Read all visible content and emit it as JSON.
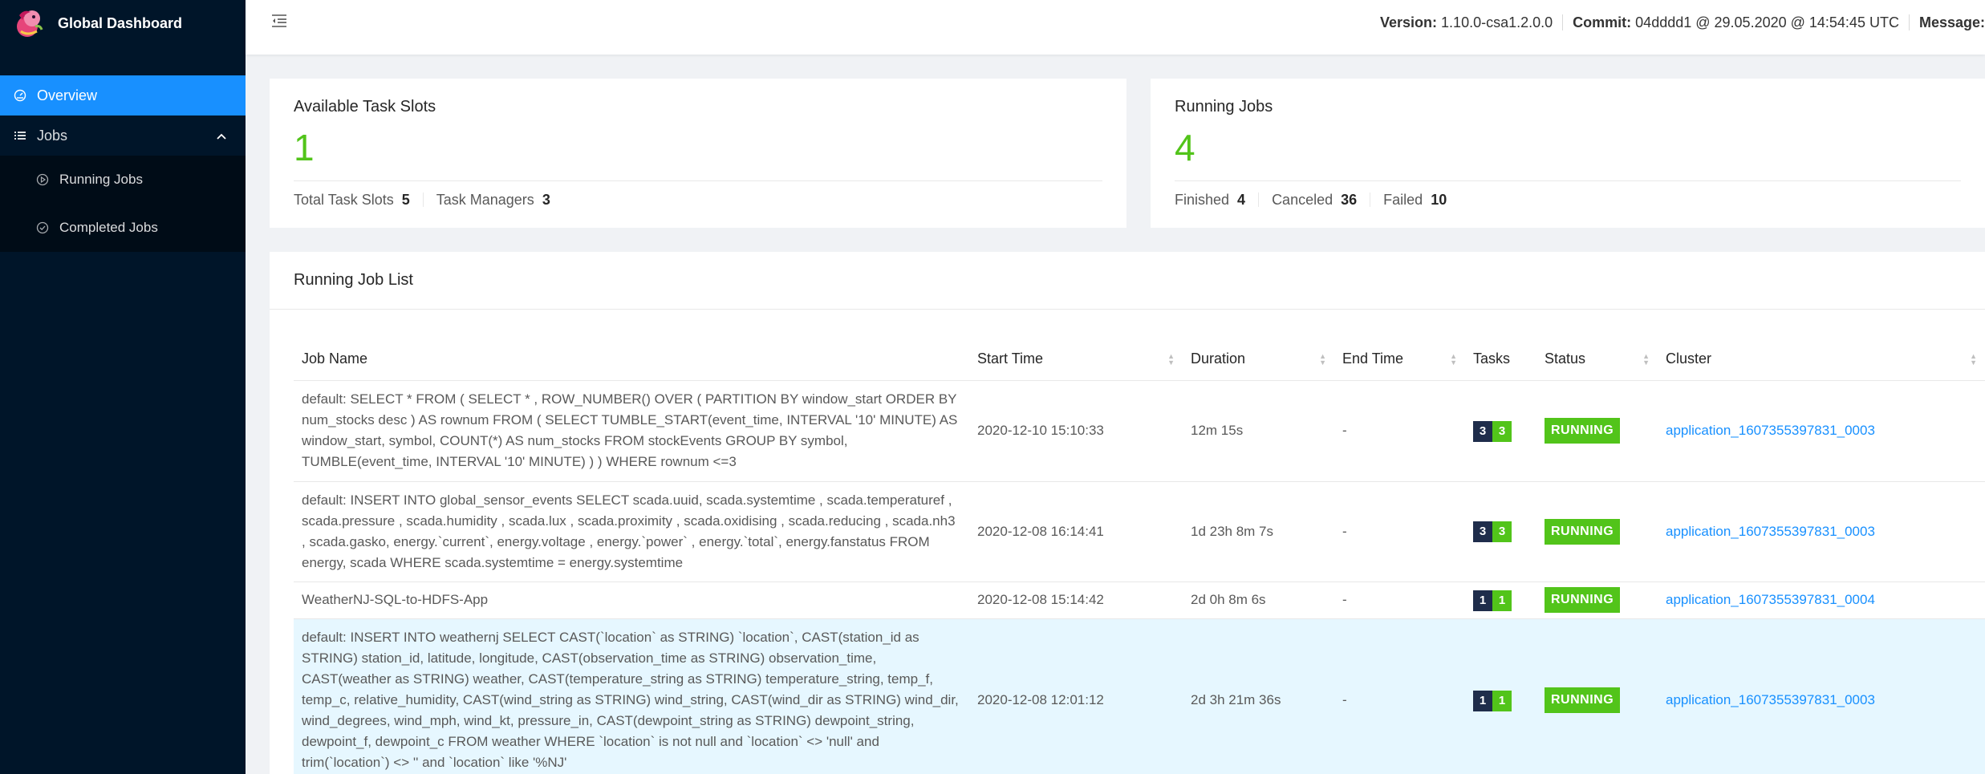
{
  "brand": {
    "title": "Global Dashboard"
  },
  "sidebar": {
    "items": [
      {
        "label": "Overview",
        "icon": "dashboard-icon"
      },
      {
        "label": "Jobs",
        "icon": "list-icon"
      }
    ],
    "jobs_submenu": [
      {
        "label": "Running Jobs",
        "icon": "play-circle-icon"
      },
      {
        "label": "Completed Jobs",
        "icon": "check-circle-icon"
      }
    ]
  },
  "header": {
    "version_label": "Version:",
    "version_value": "1.10.0-csa1.2.0.0",
    "commit_label": "Commit:",
    "commit_value": "04dddd1 @ 29.05.2020 @ 14:54:45 UTC",
    "message_label": "Message:"
  },
  "task_slots": {
    "title": "Available Task Slots",
    "value": "1",
    "total_label": "Total Task Slots",
    "total_value": "5",
    "managers_label": "Task Managers",
    "managers_value": "3"
  },
  "running_jobs": {
    "title": "Running Jobs",
    "value": "4",
    "finished_label": "Finished",
    "finished_value": "4",
    "canceled_label": "Canceled",
    "canceled_value": "36",
    "failed_label": "Failed",
    "failed_value": "10"
  },
  "job_list": {
    "title": "Running Job List",
    "columns": [
      "Job Name",
      "Start Time",
      "Duration",
      "End Time",
      "Tasks",
      "Status",
      "Cluster"
    ],
    "rows": [
      {
        "name": "default: SELECT * FROM ( SELECT * , ROW_NUMBER() OVER ( PARTITION BY window_start ORDER BY num_stocks desc ) AS rownum FROM ( SELECT TUMBLE_START(event_time, INTERVAL '10' MINUTE) AS window_start, symbol, COUNT(*) AS num_stocks FROM stockEvents GROUP BY symbol, TUMBLE(event_time, INTERVAL '10' MINUTE) ) ) WHERE rownum <=3",
        "start": "2020-12-10 15:10:33",
        "duration": "12m 15s",
        "end": "-",
        "tasks_total": "3",
        "tasks_running": "3",
        "status": "RUNNING",
        "cluster": "application_1607355397831_0003"
      },
      {
        "name": "default: INSERT INTO global_sensor_events SELECT scada.uuid, scada.systemtime , scada.temperaturef , scada.pressure , scada.humidity , scada.lux , scada.proximity , scada.oxidising , scada.reducing , scada.nh3 , scada.gasko, energy.`current`, energy.voltage , energy.`power` , energy.`total`, energy.fanstatus FROM energy, scada WHERE scada.systemtime = energy.systemtime",
        "start": "2020-12-08 16:14:41",
        "duration": "1d 23h 8m 7s",
        "end": "-",
        "tasks_total": "3",
        "tasks_running": "3",
        "status": "RUNNING",
        "cluster": "application_1607355397831_0003"
      },
      {
        "name": "WeatherNJ-SQL-to-HDFS-App",
        "start": "2020-12-08 15:14:42",
        "duration": "2d 0h 8m 6s",
        "end": "-",
        "tasks_total": "1",
        "tasks_running": "1",
        "status": "RUNNING",
        "cluster": "application_1607355397831_0004"
      },
      {
        "name": "default: INSERT INTO weathernj SELECT CAST(`location` as STRING) `location`, CAST(station_id as STRING) station_id, latitude, longitude, CAST(observation_time as STRING) observation_time, CAST(weather as STRING) weather, CAST(temperature_string as STRING) temperature_string, temp_f, temp_c, relative_humidity, CAST(wind_string as STRING) wind_string, CAST(wind_dir as STRING) wind_dir, wind_degrees, wind_mph, wind_kt, pressure_in, CAST(dewpoint_string as STRING) dewpoint_string, dewpoint_f, dewpoint_c FROM weather WHERE `location` is not null and `location` <> 'null' and trim(`location`) <> '' and `location` like '%NJ'",
        "start": "2020-12-08 12:01:12",
        "duration": "2d 3h 21m 36s",
        "end": "-",
        "tasks_total": "1",
        "tasks_running": "1",
        "status": "RUNNING",
        "cluster": "application_1607355397831_0003"
      }
    ]
  },
  "colors": {
    "sidebar_bg": "#001529",
    "accent": "#1890ff",
    "success": "#52c41a",
    "task_dark": "#1f2d4b",
    "selected_row": "#e6f7ff"
  }
}
